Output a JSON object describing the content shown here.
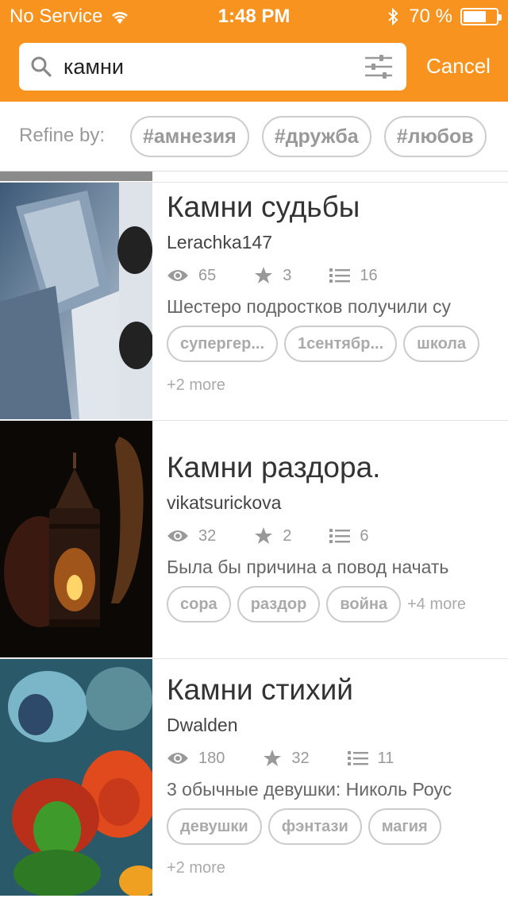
{
  "status": {
    "carrier": "No Service",
    "time": "1:48 PM",
    "battery": "70 %",
    "battery_level": 0.7
  },
  "search": {
    "query": "камни",
    "cancel_label": "Cancel"
  },
  "refine": {
    "label": "Refine by:",
    "tags": [
      "#амнезия",
      "#дружба",
      "#любов"
    ]
  },
  "stories": [
    {
      "title": "Камни судьбы",
      "author": "Lerachka147",
      "reads": "65",
      "votes": "3",
      "parts": "16",
      "description": "Шестеро подростков получили су",
      "tags": [
        "супергер...",
        "1сентябр...",
        "школа"
      ],
      "more": "+2 more"
    },
    {
      "title": "Камни раздора.",
      "author": "vikatsurickova",
      "reads": "32",
      "votes": "2",
      "parts": "6",
      "description": "Была бы причина а повод начать",
      "tags": [
        "сора",
        "раздор",
        "война"
      ],
      "more": "+4 more"
    },
    {
      "title": "Камни стихий",
      "author": "Dwalden",
      "reads": "180",
      "votes": "32",
      "parts": "11",
      "description": "3 обычные девушки: Николь Роус",
      "tags": [
        "девушки",
        "фэнтази",
        "магия"
      ],
      "more": "+2 more"
    }
  ]
}
